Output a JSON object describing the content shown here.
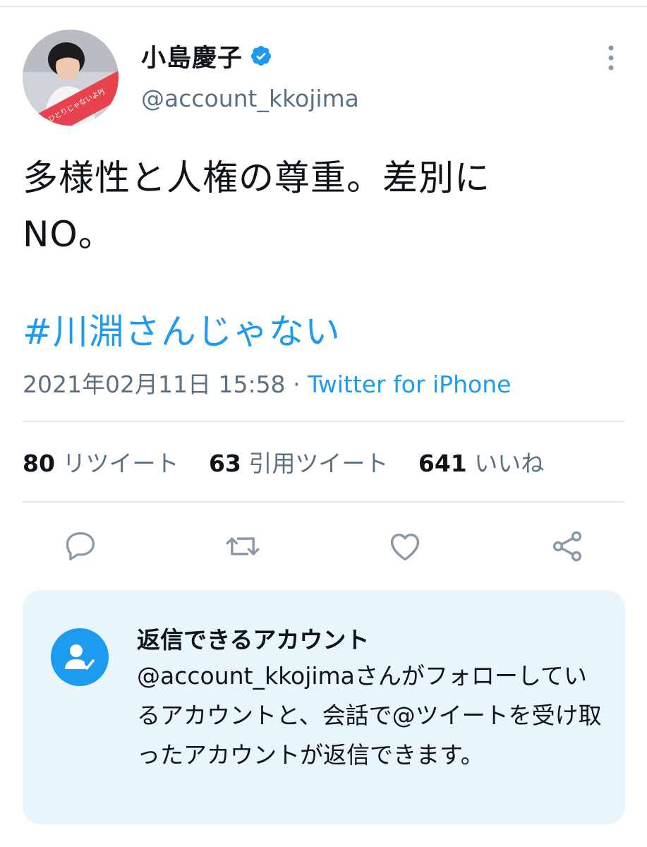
{
  "tweet": {
    "author_name": "小島慶子",
    "author_handle": "@account_kkojima",
    "avatar_badge_text": "#ひとりじゃないよPJ",
    "verified": true,
    "text": "多様性と人権の尊重。差別に\nNO。",
    "hashtag": "#川淵さんじゃない",
    "timestamp": "2021年02月11日 15:58",
    "separator": "·",
    "source": "Twitter for iPhone"
  },
  "stats": {
    "retweets_count": "80",
    "retweets_label": "リツイート",
    "quotes_count": "63",
    "quotes_label": "引用ツイート",
    "likes_count": "641",
    "likes_label": "いいね"
  },
  "actions": [
    "reply-icon",
    "retweet-icon",
    "like-icon",
    "share-icon"
  ],
  "reply_settings": {
    "title": "返信できるアカウント",
    "body": "@account_kkojimaさんがフォローしているアカウントと、会話で@ツイートを受け取ったアカウントが返信できます。",
    "icon": "user-check-icon"
  },
  "colors": {
    "accent": "#1d9bf0",
    "secondary_text": "#5b7083",
    "panel_background": "#e8f5fd",
    "avatar_ribbon": "#e8424e"
  }
}
